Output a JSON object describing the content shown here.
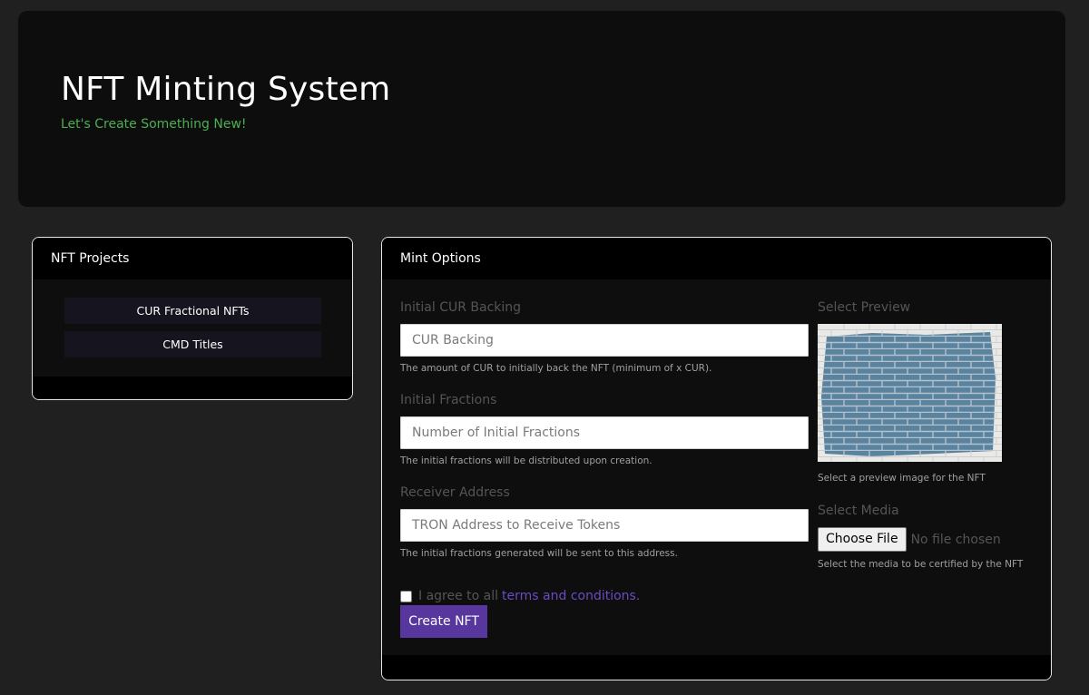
{
  "hero": {
    "title": "NFT Minting System",
    "subtitle": "Let's Create Something New!"
  },
  "projects": {
    "header": "NFT Projects",
    "items": [
      {
        "label": "CUR Fractional NFTs"
      },
      {
        "label": "CMD Titles"
      }
    ]
  },
  "mint": {
    "header": "Mint Options",
    "cur_backing": {
      "label": "Initial CUR Backing",
      "placeholder": "CUR Backing",
      "value": "",
      "help": "The amount of CUR to initially back the NFT (minimum of x CUR)."
    },
    "fractions": {
      "label": "Initial Fractions",
      "placeholder": "Number of Initial Fractions",
      "value": "",
      "help": "The initial fractions will be distributed upon creation."
    },
    "receiver": {
      "label": "Receiver Address",
      "placeholder": "TRON Address to Receive Tokens",
      "value": "",
      "help": "The initial fractions generated will be sent to this address."
    },
    "preview": {
      "label": "Select Preview",
      "help": "Select a preview image for the NFT"
    },
    "media": {
      "label": "Select Media",
      "button": "Choose File",
      "status": "No file chosen",
      "help": "Select the media to be certified by the NFT"
    },
    "agree": {
      "text": "I agree to all",
      "link": "terms and conditions."
    },
    "submit": "Create NFT"
  },
  "colors": {
    "accent": "#57379e",
    "link": "#6a4bc4",
    "subtitle": "#4caf50",
    "page_bg": "#202020"
  }
}
